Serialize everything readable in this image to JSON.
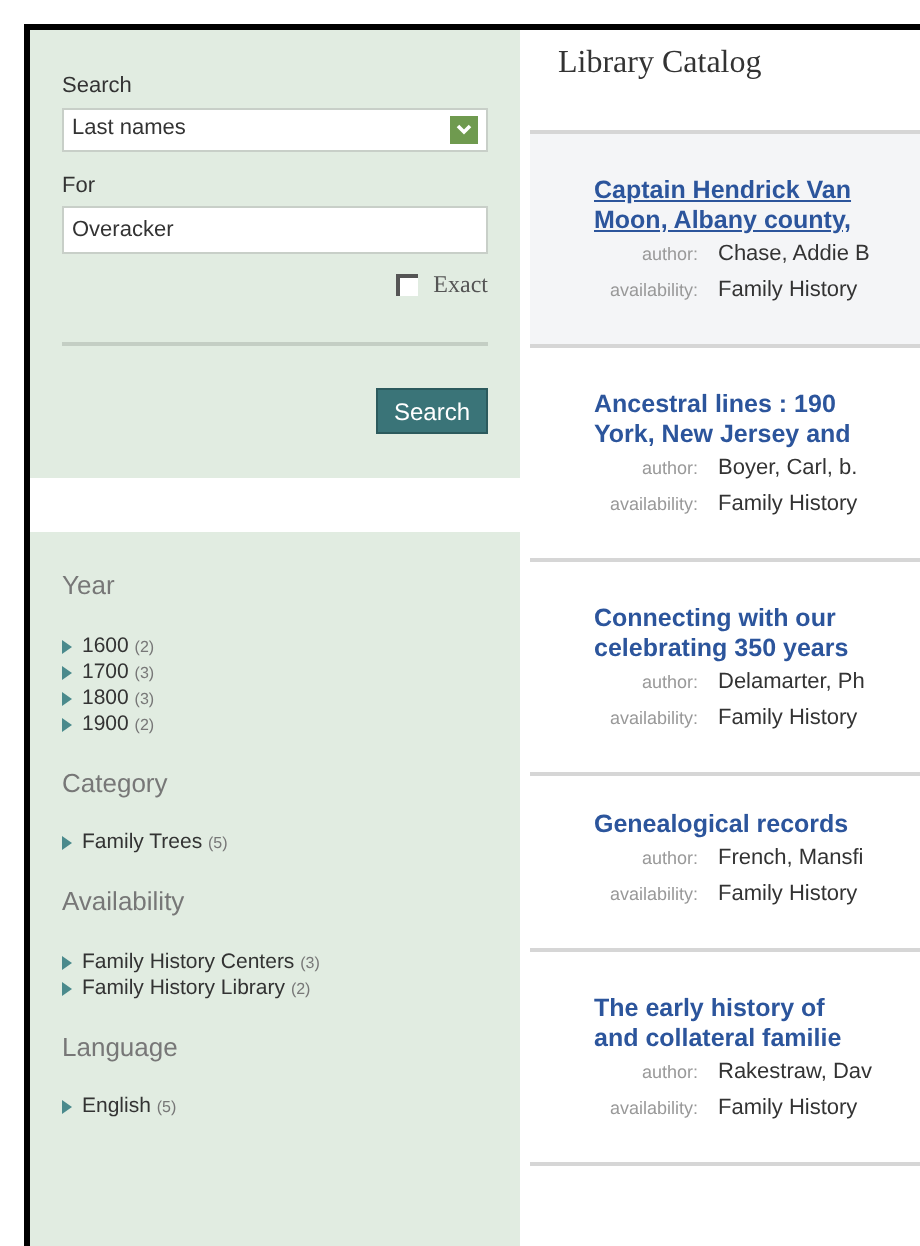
{
  "search_form": {
    "search_label": "Search",
    "search_select": "Last names",
    "for_label": "For",
    "for_value": "Overacker",
    "exact": {
      "label": "Exact",
      "checked": false
    },
    "button": "Search"
  },
  "facets": [
    {
      "heading": "Year",
      "items": [
        {
          "label": "1600",
          "count": "(2)"
        },
        {
          "label": "1700",
          "count": "(3)"
        },
        {
          "label": "1800",
          "count": "(3)"
        },
        {
          "label": "1900",
          "count": "(2)"
        }
      ]
    },
    {
      "heading": "Category",
      "items": [
        {
          "label": "Family Trees",
          "count": "(5)"
        }
      ]
    },
    {
      "heading": "Availability",
      "items": [
        {
          "label": "Family History Centers",
          "count": "(3)"
        },
        {
          "label": "Family History Library",
          "count": "(2)"
        }
      ]
    },
    {
      "heading": "Language",
      "items": [
        {
          "label": "English",
          "count": "(5)"
        }
      ]
    }
  ],
  "page_title": "Library Catalog",
  "results": [
    {
      "title_lines": [
        "Captain Hendrick Van",
        "Moon, Albany county,"
      ],
      "hovered": true,
      "author_label": "author:",
      "author": "Chase, Addie B",
      "availability_label": "availability:",
      "availability": "Family History"
    },
    {
      "title_lines": [
        "Ancestral lines : 190",
        "York, New Jersey and"
      ],
      "hovered": false,
      "author_label": "author:",
      "author": "Boyer, Carl, b.",
      "availability_label": "availability:",
      "availability": "Family History"
    },
    {
      "title_lines": [
        "Connecting with our",
        "celebrating 350 years"
      ],
      "hovered": false,
      "author_label": "author:",
      "author": "Delamarter, Ph",
      "availability_label": "availability:",
      "availability": "Family History"
    },
    {
      "title_lines": [
        "Genealogical records"
      ],
      "hovered": false,
      "author_label": "author:",
      "author": "French, Mansfi",
      "availability_label": "availability:",
      "availability": "Family History"
    },
    {
      "title_lines": [
        "The early history of",
        "and collateral familie"
      ],
      "hovered": false,
      "author_label": "author:",
      "author": "Rakestraw, Dav",
      "availability_label": "availability:",
      "availability": "Family History"
    }
  ]
}
